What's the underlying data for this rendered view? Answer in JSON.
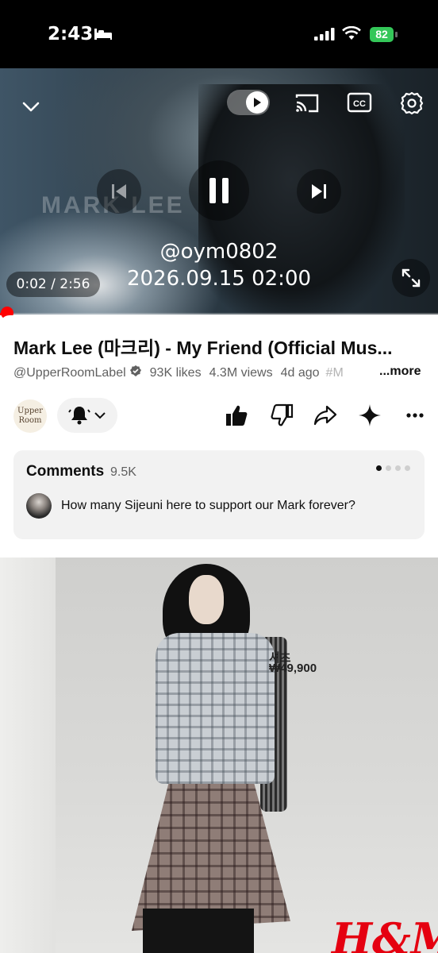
{
  "status_bar": {
    "time": "2:43",
    "battery": "82"
  },
  "player": {
    "watermark": "MARK LEE",
    "overlay_handle": "@oym0802",
    "overlay_datetime": "2026.09.15 02:00",
    "time_display": "0:02 / 2:56",
    "progress_fraction": 0.011,
    "autoplay": true
  },
  "video": {
    "title": "Mark Lee (마크리) - My Friend (Official Mus...",
    "channel": "@UpperRoomLabel",
    "likes": "93K likes",
    "views": "4.3M views",
    "age": "4d ago",
    "hashtag": "#M",
    "more_label": "...more"
  },
  "channel_avatar": {
    "line1": "Upper",
    "line2": "Room"
  },
  "actions": [
    "like-icon",
    "dislike-icon",
    "share-icon",
    "sparkle-icon",
    "more-icon"
  ],
  "comments": {
    "header": "Comments",
    "count": "9.5K",
    "top_comment": "How many Sijeuni here to support our Mark forever?",
    "page_dots": 4,
    "active_dot": 0
  },
  "ad": {
    "item_label": "셔츠",
    "price": "₩49,900",
    "logo": "H&M"
  },
  "colors": {
    "accent": "#ff0000",
    "battery": "#34c759",
    "ad_logo": "#e50010"
  }
}
